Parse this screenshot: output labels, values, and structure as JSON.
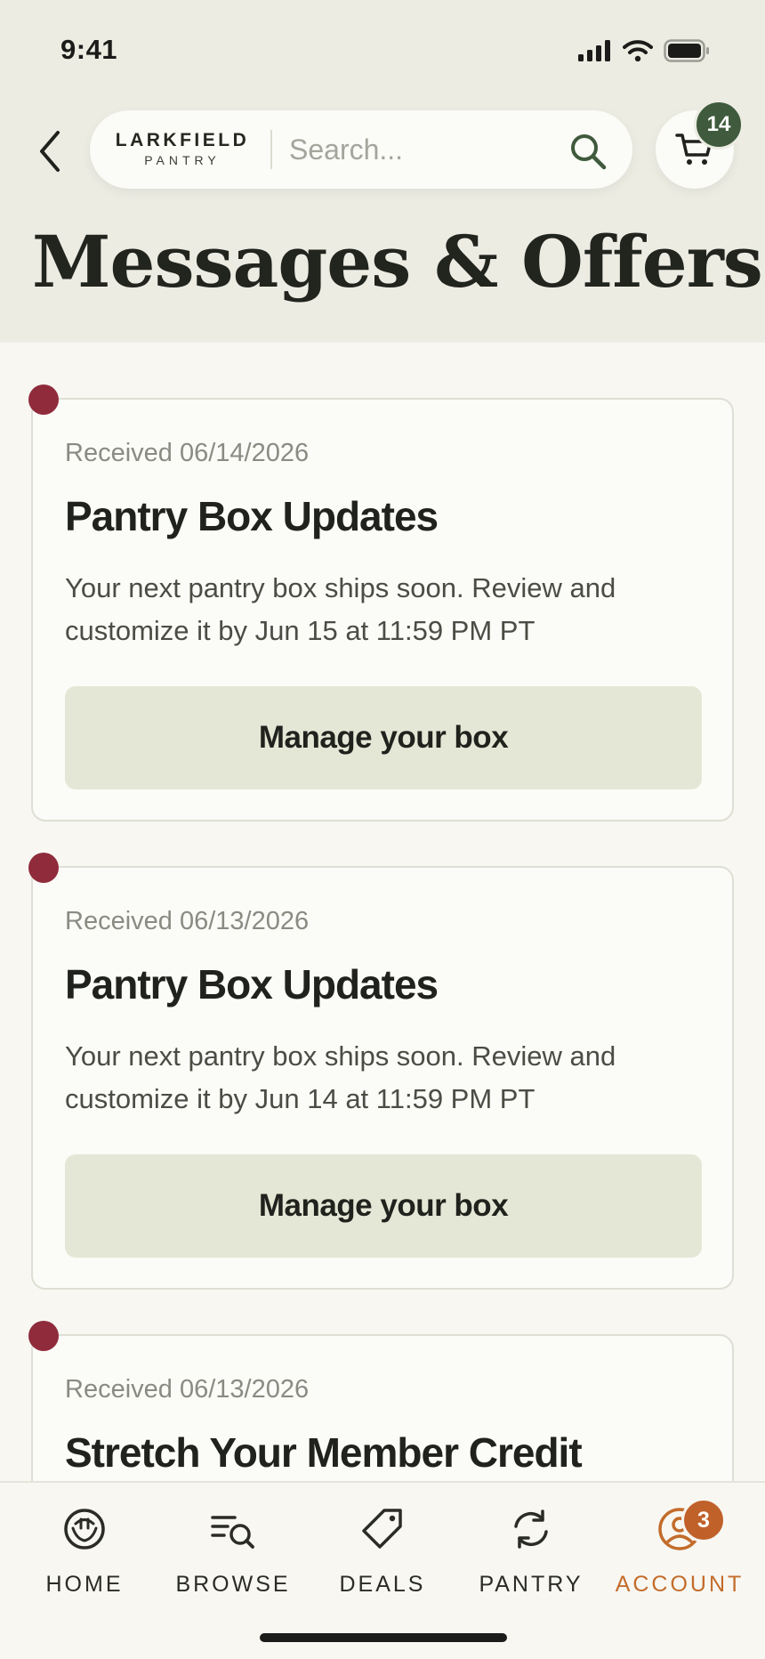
{
  "status_bar": {
    "time": "9:41"
  },
  "header": {
    "logo_main": "LARKFIELD",
    "logo_sub": "PANTRY",
    "search_placeholder": "Search...",
    "cart_count": "14"
  },
  "page": {
    "title": "Messages & Offers"
  },
  "messages": [
    {
      "date": "Received 06/14/2026",
      "title": "Pantry Box Updates",
      "body": "Your next pantry box ships soon. Review and customize it by Jun 15 at 11:59 PM PT",
      "button": "Manage your box",
      "unread": true
    },
    {
      "date": "Received 06/13/2026",
      "title": "Pantry Box Updates",
      "body": "Your next pantry box ships soon. Review and customize it by Jun 14 at 11:59 PM PT",
      "button": "Manage your box",
      "unread": true
    },
    {
      "date": "Received 06/13/2026",
      "title": "Stretch Your Member Credit",
      "unread": true
    }
  ],
  "nav": {
    "items": [
      {
        "label": "HOME",
        "icon": "home-icon"
      },
      {
        "label": "BROWSE",
        "icon": "browse-icon"
      },
      {
        "label": "DEALS",
        "icon": "tag-icon"
      },
      {
        "label": "PANTRY",
        "icon": "refresh-icon"
      },
      {
        "label": "ACCOUNT",
        "icon": "account-icon",
        "active": true
      }
    ],
    "account_badge": "3"
  },
  "colors": {
    "header_bg": "#ecece3",
    "page_bg": "#f8f7f2",
    "unread_dot": "#8f2b3b",
    "button_bg": "#e5e7d6",
    "cart_badge": "#3f5a3c",
    "active_nav": "#c36c2b",
    "account_badge": "#c0612a"
  }
}
